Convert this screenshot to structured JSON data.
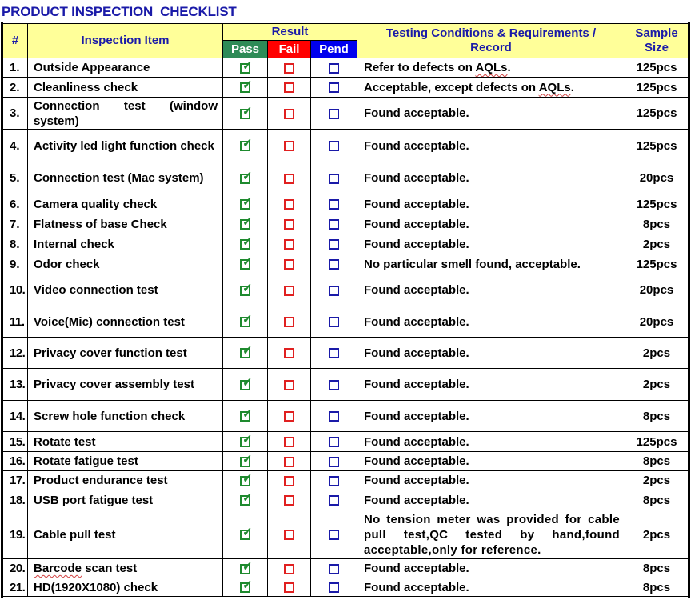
{
  "title": "PRODUCT INSPECTION  CHECKLIST",
  "header": {
    "number": "#",
    "item": "Inspection Item",
    "result": "Result",
    "pass": "Pass",
    "fail": "Fail",
    "pend": "Pend",
    "conditions": "Testing Conditions & Requirements / Record",
    "sample_size": "Sample Size"
  },
  "colors": {
    "title": "#1a1aa8",
    "header_bg": "#ffff99",
    "pass": "#2e8b57",
    "fail": "#ff0000",
    "pend": "#0000ee"
  },
  "rows": [
    {
      "no": "1.",
      "item": "Outside Appearance",
      "result": "pass",
      "conditions": "Refer to defects on AQLs.",
      "sample": "125pcs"
    },
    {
      "no": "2.",
      "item": "Cleanliness check",
      "result": "pass",
      "conditions": "Acceptable, except defects on AQLs.",
      "sample": "125pcs"
    },
    {
      "no": "3.",
      "item": "Connection test (window system)",
      "result": "pass",
      "conditions": "Found acceptable.",
      "sample": "125pcs"
    },
    {
      "no": "4.",
      "item": "Activity led light function check",
      "result": "pass",
      "conditions": "Found acceptable.",
      "sample": "125pcs"
    },
    {
      "no": "5.",
      "item": "Connection test (Mac system)",
      "result": "pass",
      "conditions": "Found acceptable.",
      "sample": "20pcs"
    },
    {
      "no": "6.",
      "item": "Camera quality check",
      "result": "pass",
      "conditions": "Found acceptable.",
      "sample": "125pcs"
    },
    {
      "no": "7.",
      "item": "Flatness of base Check",
      "result": "pass",
      "conditions": "Found acceptable.",
      "sample": "8pcs"
    },
    {
      "no": "8.",
      "item": "Internal check",
      "result": "pass",
      "conditions": "Found acceptable.",
      "sample": "2pcs"
    },
    {
      "no": "9.",
      "item": "Odor check",
      "result": "pass",
      "conditions": "No particular smell found, acceptable.",
      "sample": "125pcs"
    },
    {
      "no": "10.",
      "item": "Video connection test",
      "result": "pass",
      "conditions": "Found acceptable.",
      "sample": "20pcs"
    },
    {
      "no": "11.",
      "item": "Voice(Mic) connection test",
      "result": "pass",
      "conditions": "Found acceptable.",
      "sample": "20pcs"
    },
    {
      "no": "12.",
      "item": "Privacy cover function test",
      "result": "pass",
      "conditions": "Found acceptable.",
      "sample": "2pcs"
    },
    {
      "no": "13.",
      "item": "Privacy cover assembly test",
      "result": "pass",
      "conditions": "Found acceptable.",
      "sample": "2pcs"
    },
    {
      "no": "14.",
      "item": "Screw hole function check",
      "result": "pass",
      "conditions": "Found acceptable.",
      "sample": "8pcs"
    },
    {
      "no": "15.",
      "item": "Rotate  test",
      "result": "pass",
      "conditions": "Found acceptable.",
      "sample": "125pcs"
    },
    {
      "no": "16.",
      "item": "Rotate fatigue test",
      "result": "pass",
      "conditions": "Found acceptable.",
      "sample": "8pcs"
    },
    {
      "no": "17.",
      "item": "Product endurance test",
      "result": "pass",
      "conditions": "Found acceptable.",
      "sample": "2pcs"
    },
    {
      "no": "18.",
      "item": "USB port fatigue test",
      "result": "pass",
      "conditions": "Found acceptable.",
      "sample": "8pcs"
    },
    {
      "no": "19.",
      "item": "Cable pull test",
      "result": "pass",
      "conditions": "No tension meter was provided for cable pull test,QC tested by hand,found acceptable,only for reference.",
      "sample": "2pcs"
    },
    {
      "no": "20.",
      "item": "Barcode scan test",
      "result": "pass",
      "conditions": "Found acceptable.",
      "sample": "8pcs"
    },
    {
      "no": "21.",
      "item": "HD(1920X1080) check",
      "result": "pass",
      "conditions": "Found acceptable.",
      "sample": "8pcs"
    }
  ]
}
